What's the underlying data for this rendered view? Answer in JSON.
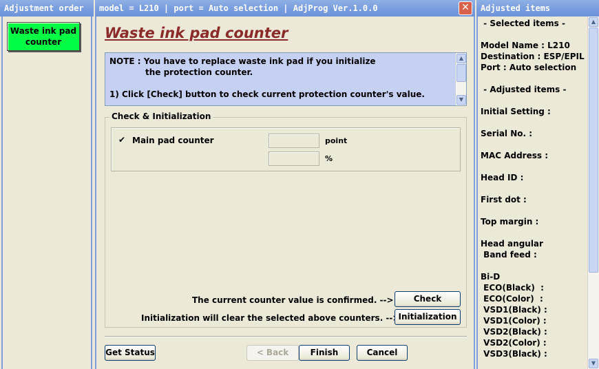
{
  "left_panel": {
    "title": "Adjustment order",
    "order_button": "Waste ink pad counter"
  },
  "center_panel": {
    "title": "model = L210 | port = Auto selection | AdjProg Ver.1.0.0",
    "close_glyph": "✕",
    "heading": "Waste ink pad counter",
    "note": {
      "line1": "NOTE : You have to replace waste ink pad if you initialize",
      "line2": "the protection counter.",
      "line3": "1) Click [Check] button to check current protection counter's value."
    },
    "group": {
      "legend": "Check & Initialization",
      "checkbox_checked": true,
      "checkbox_glyph": "✔",
      "counter_label": "Main pad counter",
      "point_value": "",
      "percent_value": "",
      "unit_point": "point",
      "unit_percent": "%"
    },
    "check_msg": "The current counter value is confirmed. -->",
    "check_button": "Check",
    "init_msg": "Initialization will clear the selected above counters. -->",
    "init_button": "Initialization",
    "buttons": {
      "get_status": "Get Status",
      "back": "< Back",
      "finish": "Finish",
      "cancel": "Cancel"
    }
  },
  "right_panel": {
    "title": "Adjusted items",
    "lines": [
      " - Selected items -",
      "",
      "Model Name : L210",
      "Destination : ESP/EPIL",
      "Port : Auto selection",
      "",
      " - Adjusted items -",
      "",
      "Initial Setting :",
      "",
      "Serial No. :",
      "",
      "MAC Address :",
      "",
      "Head ID :",
      "",
      "First dot :",
      "",
      "Top margin :",
      "",
      "Head angular",
      " Band feed :",
      "",
      "Bi-D",
      " ECO(Black)  :",
      " ECO(Color)  :",
      " VSD1(Black) :",
      " VSD1(Color) :",
      " VSD2(Black) :",
      " VSD2(Color) :",
      " VSD3(Black) :"
    ]
  },
  "colors": {
    "title_bar": "#7a9fdf",
    "heading": "#8b2a2a",
    "note_bg": "#c6d0f3",
    "order_button_bg": "#00ff44",
    "window_bg": "#ece9d8"
  }
}
